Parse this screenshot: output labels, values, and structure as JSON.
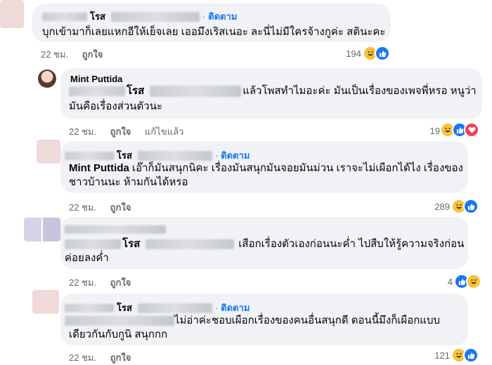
{
  "comments": [
    {
      "name": "โรส",
      "follow": "ติดตาม",
      "text_line1": "บุกเข้ามาก็เลยแหกอีให้เย็จเลย เออมึงเริสเนอะ ละนี่ไม่มีใครจ้างกูค่ะ สตินะคะ",
      "time": "22 ชม.",
      "like_label": "ถูกใจ",
      "reaction_count": "194"
    },
    {
      "name": "Mint Puttida",
      "mention": "โรส",
      "text_line1": "แล้วโพสทำไมอะค่ะ มันเป็นเรื่องของเพจพี่หรอ หนูว่า",
      "text_line2": "มันคือเรื่องส่วนตัวนะ",
      "time": "22 ชม.",
      "like_label": "ถูกใจ",
      "edited_label": "แก้ไขแล้ว",
      "reaction_count": "19"
    },
    {
      "name": "โรส",
      "follow": "ติดตาม",
      "mention": "Mint Puttida",
      "text_line1": "เอ๊าก็มันสนุกนิคะ เรื่องมันสนุกมันจอยมันม่วน เราจะไม่เผือกได้ไง เรื่องของ",
      "text_line2": "ชาวบ้านนะ ห้ามกันได้หรอ",
      "time": "22 ชม.",
      "like_label": "ถูกใจ",
      "reaction_count": "289"
    },
    {
      "mention": "โรส",
      "text_line1": "เสือกเรื่องตัวเองก่อนนะค่ำ ไปสืบให้รู้ความจริงก่อน",
      "text_line2": "ค่อยลงค่ำ",
      "time": "22 ชม.",
      "like_label": "ถูกใจ",
      "reaction_count": "4"
    },
    {
      "name": "โรส",
      "follow": "ติดตาม",
      "text_line1": "ไม่อ่าค่ะชอบเผือกเรื่องของคนอื่นสนุกดี ตอนนี้มึงก็เผือกแบบ",
      "text_line2": "เดียวกันกับกูนิ สนุกกก",
      "time": "22 ชม.",
      "like_label": "ถูกใจ",
      "reaction_count": "121"
    }
  ],
  "colors": {
    "link": "#1877f2",
    "bubble": "#f0f2f5",
    "meta": "#65676b"
  },
  "icons": [
    "haha-reaction-icon",
    "like-reaction-icon",
    "love-reaction-icon"
  ]
}
